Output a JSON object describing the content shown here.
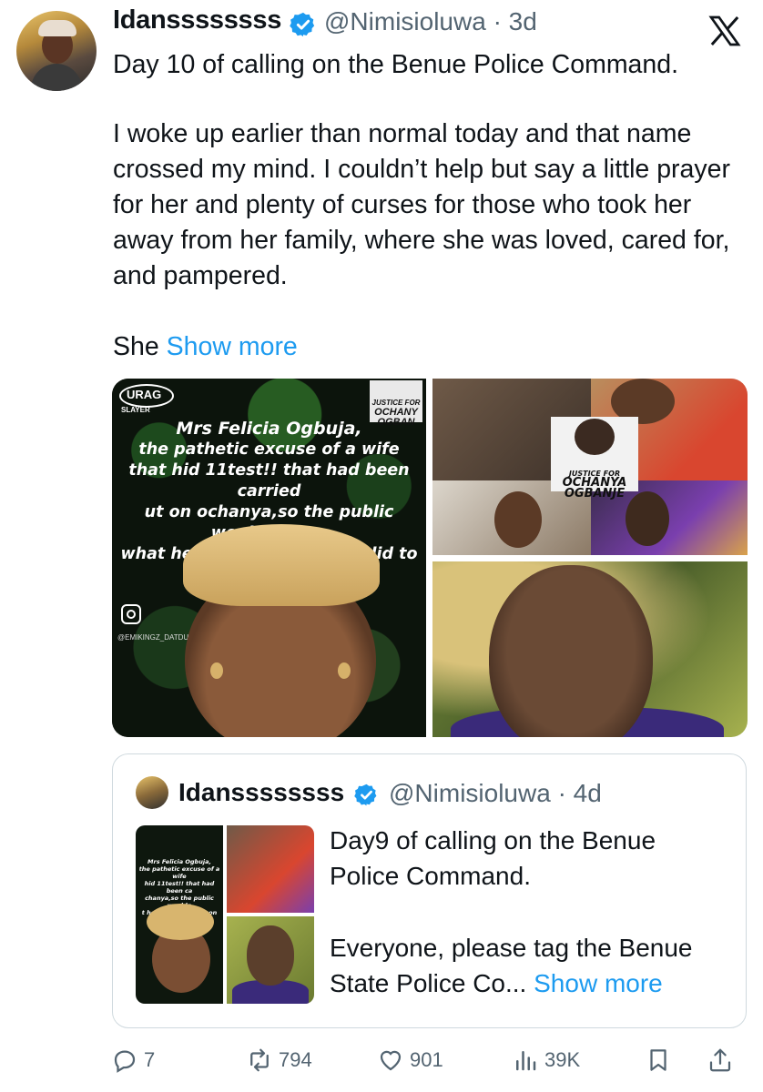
{
  "tweet": {
    "author_name": "Idanssssssss",
    "handle_time": "@Nimisioluwa · 3d",
    "text_line1": "Day 10 of calling on the Benue Police Command.",
    "text_para2": "I woke up earlier than normal today and that name crossed my mind. I couldn’t help but say a little prayer for her and plenty of curses for those who took her away from her family, where she was loved, cared for, and pampered.",
    "text_para3_start": "She ",
    "show_more": "Show more",
    "platform_logo": "x-logo-icon"
  },
  "media": {
    "image1": {
      "logo_text": "URAG",
      "logo_sub": "SLAYER",
      "tag": [
        "JUSTICE FOR",
        "OCHANY",
        "OGBAN"
      ],
      "caption": [
        "Mrs Felicia Ogbuja,",
        "the pathetic excuse of a wife",
        "that hid 11test!! that had been carried",
        "ut on ochanya,so the public wouldn't kno",
        "what her husband and son did to her"
      ],
      "watermark": "@EMIKINGZ_DATDURAGSLAYER"
    },
    "image2": {
      "tag_l1": "JUSTICE FOR",
      "tag_l2": "OCHANYA",
      "tag_l3": "OGBANJE"
    }
  },
  "quoted": {
    "author_name": "Idanssssssss",
    "handle_time": "@Nimisioluwa · 4d",
    "text1": "Day9 of calling on the Benue Police Command.",
    "text2_start": "Everyone, please tag the Benue State Police Co",
    "ellipsis": "...",
    "show_more": "Show more",
    "thumb_caption": [
      "Mrs Felicia Ogbuja,",
      "the pathetic excuse of a wife",
      "hid 11test!! that had been ca",
      "chanya,so the public wouldn",
      "t her husband and son did to"
    ]
  },
  "actions": {
    "replies": "7",
    "reposts": "794",
    "likes": "901",
    "views": "39K"
  },
  "colors": {
    "text": "#0f1419",
    "secondary": "#536471",
    "link": "#1d9bf0",
    "verified": "#1d9bf0",
    "border": "#cfd9de"
  }
}
